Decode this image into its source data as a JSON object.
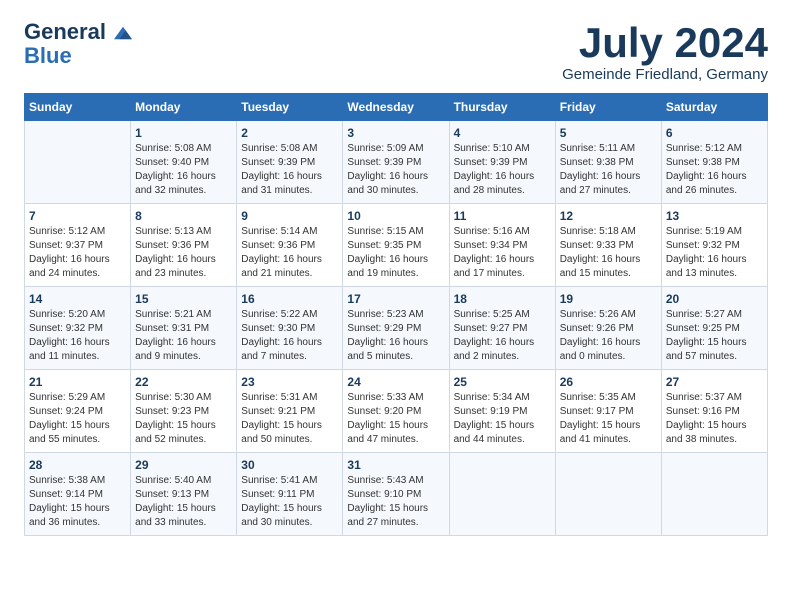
{
  "logo": {
    "line1": "General",
    "line2": "Blue"
  },
  "title": "July 2024",
  "subtitle": "Gemeinde Friedland, Germany",
  "days_of_week": [
    "Sunday",
    "Monday",
    "Tuesday",
    "Wednesday",
    "Thursday",
    "Friday",
    "Saturday"
  ],
  "weeks": [
    [
      {
        "day": "",
        "info": ""
      },
      {
        "day": "1",
        "info": "Sunrise: 5:08 AM\nSunset: 9:40 PM\nDaylight: 16 hours and 32 minutes."
      },
      {
        "day": "2",
        "info": "Sunrise: 5:08 AM\nSunset: 9:39 PM\nDaylight: 16 hours and 31 minutes."
      },
      {
        "day": "3",
        "info": "Sunrise: 5:09 AM\nSunset: 9:39 PM\nDaylight: 16 hours and 30 minutes."
      },
      {
        "day": "4",
        "info": "Sunrise: 5:10 AM\nSunset: 9:39 PM\nDaylight: 16 hours and 28 minutes."
      },
      {
        "day": "5",
        "info": "Sunrise: 5:11 AM\nSunset: 9:38 PM\nDaylight: 16 hours and 27 minutes."
      },
      {
        "day": "6",
        "info": "Sunrise: 5:12 AM\nSunset: 9:38 PM\nDaylight: 16 hours and 26 minutes."
      }
    ],
    [
      {
        "day": "7",
        "info": "Sunrise: 5:12 AM\nSunset: 9:37 PM\nDaylight: 16 hours and 24 minutes."
      },
      {
        "day": "8",
        "info": "Sunrise: 5:13 AM\nSunset: 9:36 PM\nDaylight: 16 hours and 23 minutes."
      },
      {
        "day": "9",
        "info": "Sunrise: 5:14 AM\nSunset: 9:36 PM\nDaylight: 16 hours and 21 minutes."
      },
      {
        "day": "10",
        "info": "Sunrise: 5:15 AM\nSunset: 9:35 PM\nDaylight: 16 hours and 19 minutes."
      },
      {
        "day": "11",
        "info": "Sunrise: 5:16 AM\nSunset: 9:34 PM\nDaylight: 16 hours and 17 minutes."
      },
      {
        "day": "12",
        "info": "Sunrise: 5:18 AM\nSunset: 9:33 PM\nDaylight: 16 hours and 15 minutes."
      },
      {
        "day": "13",
        "info": "Sunrise: 5:19 AM\nSunset: 9:32 PM\nDaylight: 16 hours and 13 minutes."
      }
    ],
    [
      {
        "day": "14",
        "info": "Sunrise: 5:20 AM\nSunset: 9:32 PM\nDaylight: 16 hours and 11 minutes."
      },
      {
        "day": "15",
        "info": "Sunrise: 5:21 AM\nSunset: 9:31 PM\nDaylight: 16 hours and 9 minutes."
      },
      {
        "day": "16",
        "info": "Sunrise: 5:22 AM\nSunset: 9:30 PM\nDaylight: 16 hours and 7 minutes."
      },
      {
        "day": "17",
        "info": "Sunrise: 5:23 AM\nSunset: 9:29 PM\nDaylight: 16 hours and 5 minutes."
      },
      {
        "day": "18",
        "info": "Sunrise: 5:25 AM\nSunset: 9:27 PM\nDaylight: 16 hours and 2 minutes."
      },
      {
        "day": "19",
        "info": "Sunrise: 5:26 AM\nSunset: 9:26 PM\nDaylight: 16 hours and 0 minutes."
      },
      {
        "day": "20",
        "info": "Sunrise: 5:27 AM\nSunset: 9:25 PM\nDaylight: 15 hours and 57 minutes."
      }
    ],
    [
      {
        "day": "21",
        "info": "Sunrise: 5:29 AM\nSunset: 9:24 PM\nDaylight: 15 hours and 55 minutes."
      },
      {
        "day": "22",
        "info": "Sunrise: 5:30 AM\nSunset: 9:23 PM\nDaylight: 15 hours and 52 minutes."
      },
      {
        "day": "23",
        "info": "Sunrise: 5:31 AM\nSunset: 9:21 PM\nDaylight: 15 hours and 50 minutes."
      },
      {
        "day": "24",
        "info": "Sunrise: 5:33 AM\nSunset: 9:20 PM\nDaylight: 15 hours and 47 minutes."
      },
      {
        "day": "25",
        "info": "Sunrise: 5:34 AM\nSunset: 9:19 PM\nDaylight: 15 hours and 44 minutes."
      },
      {
        "day": "26",
        "info": "Sunrise: 5:35 AM\nSunset: 9:17 PM\nDaylight: 15 hours and 41 minutes."
      },
      {
        "day": "27",
        "info": "Sunrise: 5:37 AM\nSunset: 9:16 PM\nDaylight: 15 hours and 38 minutes."
      }
    ],
    [
      {
        "day": "28",
        "info": "Sunrise: 5:38 AM\nSunset: 9:14 PM\nDaylight: 15 hours and 36 minutes."
      },
      {
        "day": "29",
        "info": "Sunrise: 5:40 AM\nSunset: 9:13 PM\nDaylight: 15 hours and 33 minutes."
      },
      {
        "day": "30",
        "info": "Sunrise: 5:41 AM\nSunset: 9:11 PM\nDaylight: 15 hours and 30 minutes."
      },
      {
        "day": "31",
        "info": "Sunrise: 5:43 AM\nSunset: 9:10 PM\nDaylight: 15 hours and 27 minutes."
      },
      {
        "day": "",
        "info": ""
      },
      {
        "day": "",
        "info": ""
      },
      {
        "day": "",
        "info": ""
      }
    ]
  ]
}
